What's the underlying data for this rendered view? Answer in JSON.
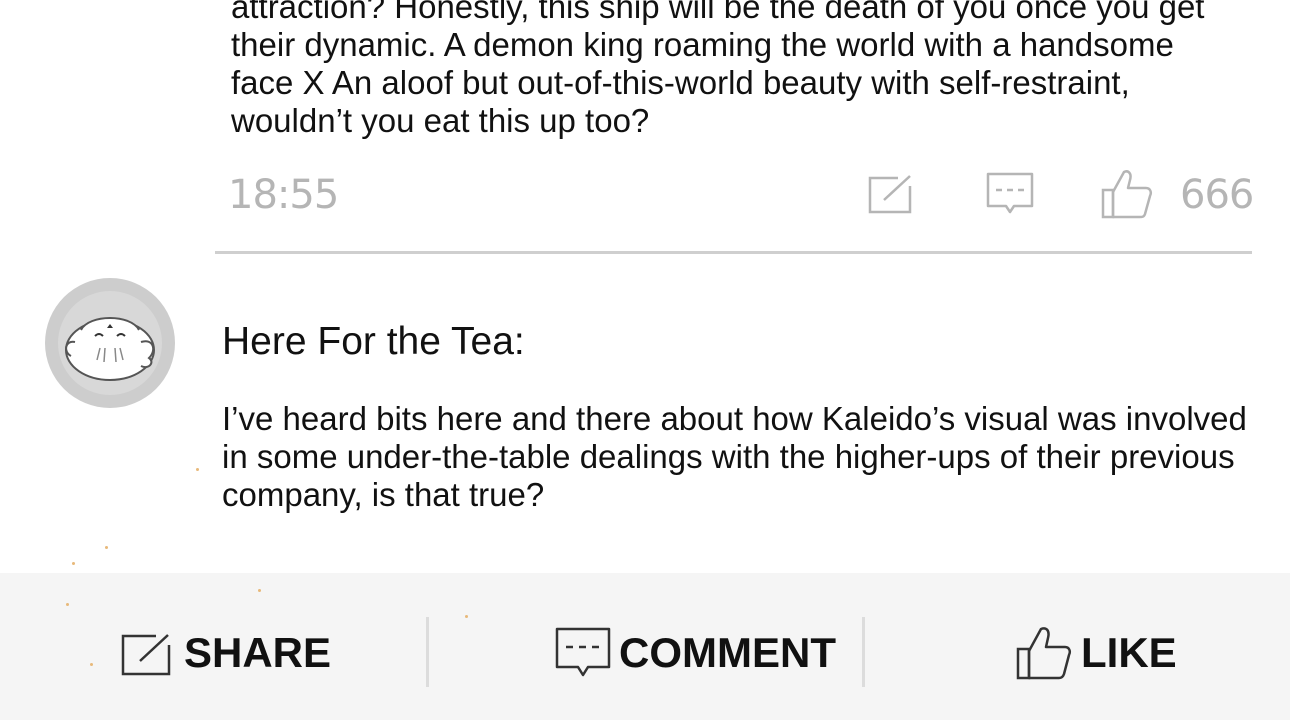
{
  "previous_comment": {
    "text": "attraction? Honestly, this ship will be the death of you once you get their dynamic. A demon king roaming the world with a handsome face X An aloof but out-of-this-world beauty with self-restraint, wouldn’t you eat this up too?",
    "time": "18:55",
    "likes": "666",
    "icons": [
      "share-icon",
      "comment-icon",
      "like-icon"
    ]
  },
  "comment": {
    "author": "Here For the Tea:",
    "text": "I’ve heard bits here and there about how Kaleido’s visual was involved in some under-the-table dealings with the higher-ups of their previous company, is that true?",
    "avatar": "seal-cartoon-avatar"
  },
  "action_bar": {
    "share_label": "SHARE",
    "comment_label": "COMMENT",
    "like_label": "LIKE"
  },
  "colors": {
    "muted_text": "#b5b5b5",
    "action_bar_bg": "#f5f5f5",
    "divider": "#cfcfcf",
    "avatar_bg": "#cdcdcd"
  }
}
